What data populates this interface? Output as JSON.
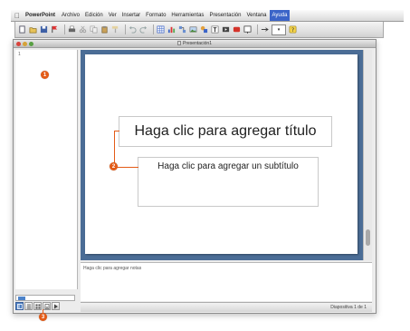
{
  "menubar": {
    "apple_icon": "apple-icon",
    "app_name": "PowerPoint",
    "items": [
      "Archivo",
      "Edición",
      "Ver",
      "Insertar",
      "Formato",
      "Herramientas",
      "Presentación",
      "Ventana",
      "Ayuda"
    ],
    "active_item": "Ayuda"
  },
  "toolbar": {
    "icons": [
      "new-icon",
      "open-icon",
      "save-icon",
      "flag-icon",
      "print-icon",
      "cut-icon",
      "copy-icon",
      "paste-icon",
      "format-painter-icon",
      "undo-icon",
      "redo-icon",
      "table-icon",
      "chart-icon",
      "smartart-icon",
      "picture-icon",
      "shapes-icon",
      "textbox-icon",
      "media-icon",
      "record-icon",
      "slideshow-icon",
      "zoom-icon",
      "help-icon"
    ]
  },
  "window": {
    "title": "Presentación1"
  },
  "thumb_pane": {
    "slide_number": "1"
  },
  "callouts": {
    "one": "1",
    "two": "2",
    "three": "3"
  },
  "slide": {
    "title_placeholder": "Haga clic para agregar título",
    "subtitle_placeholder": "Haga clic para agregar un subtítulo"
  },
  "notes": {
    "placeholder": "Haga clic para agregar notas"
  },
  "statusbar": {
    "text": "Diapositiva 1 de 1"
  },
  "colors": {
    "callout": "#e35b17",
    "slide_background": "#4b6d96",
    "menu_active": "#3b64c8"
  }
}
